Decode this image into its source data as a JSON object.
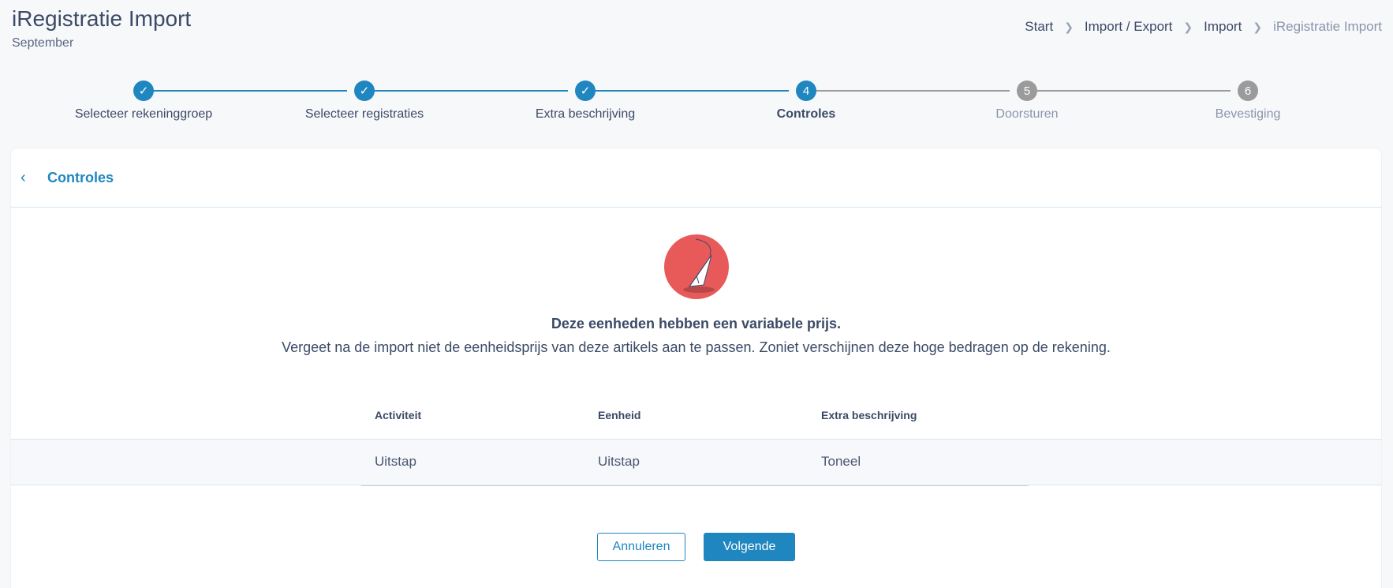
{
  "header": {
    "title": "iRegistratie Import",
    "subtitle": "September"
  },
  "breadcrumb": [
    "Start",
    "Import / Export",
    "Import",
    "iRegistratie Import"
  ],
  "steps": [
    {
      "number": "1",
      "label": "Selecteer rekeninggroep",
      "state": "done"
    },
    {
      "number": "2",
      "label": "Selecteer registraties",
      "state": "done"
    },
    {
      "number": "3",
      "label": "Extra beschrijving",
      "state": "done"
    },
    {
      "number": "4",
      "label": "Controles",
      "state": "active"
    },
    {
      "number": "5",
      "label": "Doorsturen",
      "state": "todo"
    },
    {
      "number": "6",
      "label": "Bevestiging",
      "state": "todo"
    }
  ],
  "card": {
    "title": "Controles",
    "message_title": "Deze eenheden hebben een variabele prijs.",
    "message_body": "Vergeet na de import niet de eenheidsprijs van deze artikels aan te passen. Zoniet verschijnen deze hoge bedragen op de rekening.",
    "table": {
      "headers": [
        "Activiteit",
        "Eenheid",
        "Extra beschrijving"
      ],
      "rows": [
        [
          "Uitstap",
          "Uitstap",
          "Toneel"
        ]
      ]
    },
    "cancel_label": "Annuleren",
    "next_label": "Volgende"
  },
  "colors": {
    "accent": "#1f86c0",
    "todo": "#9b9b9b",
    "illustration": "#e85a5a"
  },
  "icons": {
    "back": "chevron-left-icon",
    "done": "check-icon",
    "illustration": "paper-plane-icon"
  }
}
